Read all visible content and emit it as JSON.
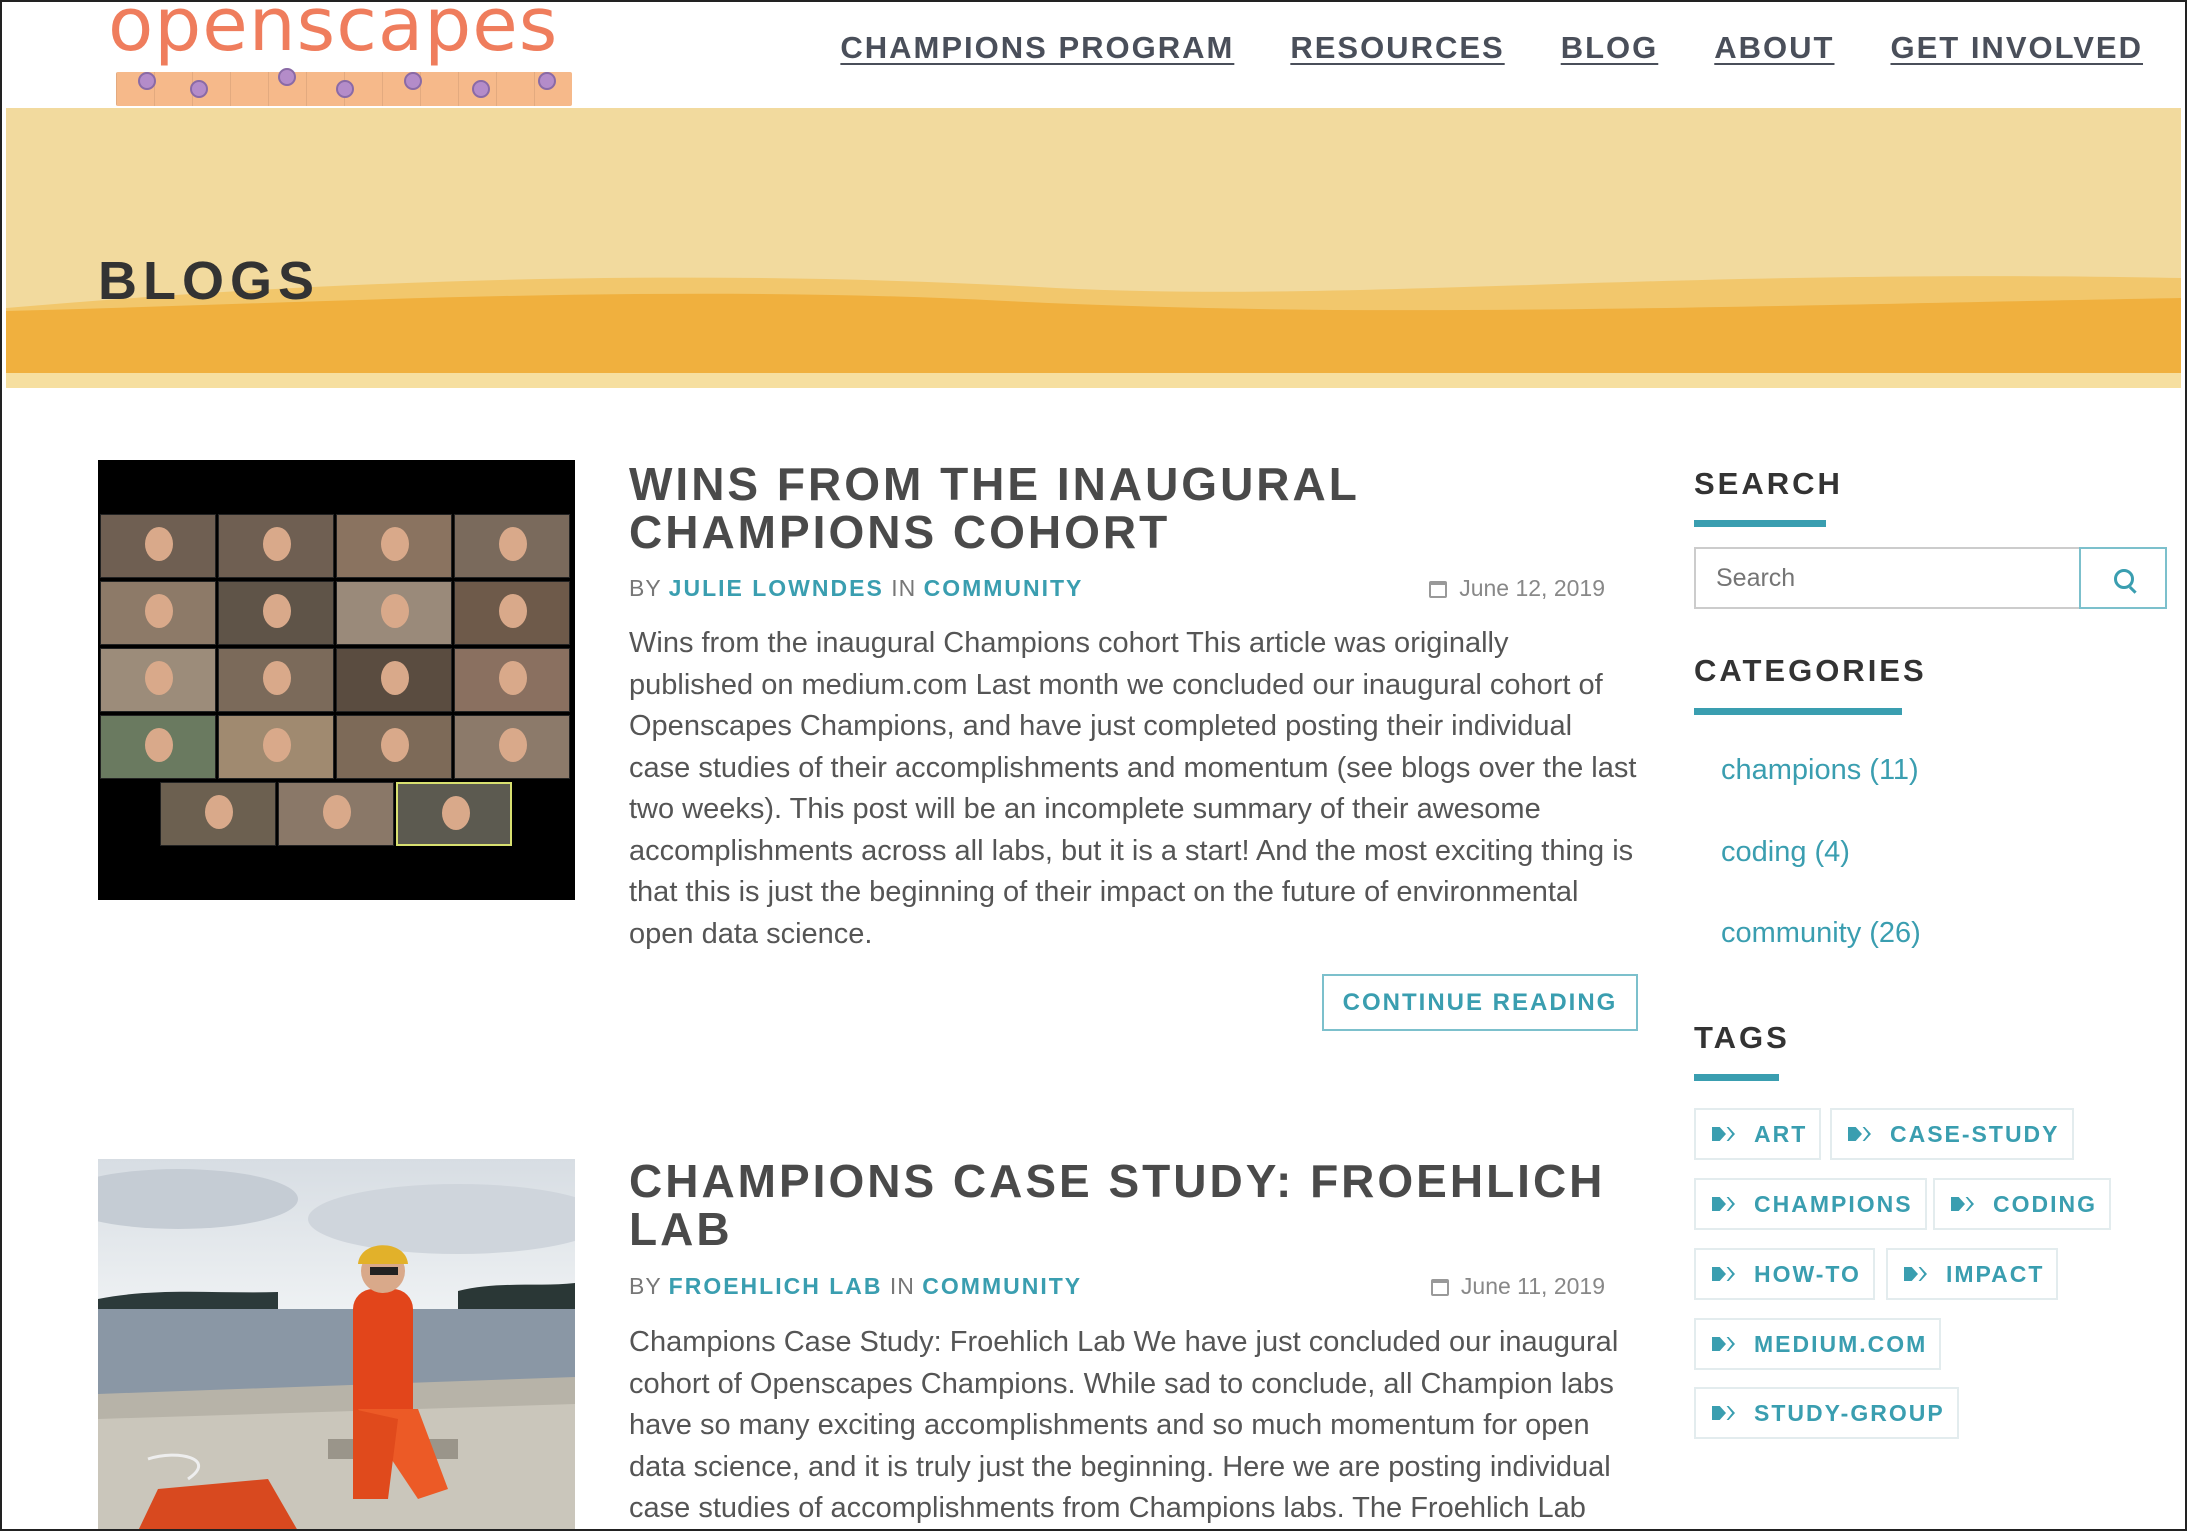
{
  "site": {
    "logo_text": "openscapes",
    "nav": [
      "CHAMPIONS PROGRAM",
      "RESOURCES",
      "BLOG",
      "ABOUT",
      "GET INVOLVED"
    ]
  },
  "banner": {
    "title": "BLOGS"
  },
  "posts": [
    {
      "title": "WINS FROM THE INAUGURAL CHAMPIONS COHORT",
      "by": "BY",
      "author": "JULIE LOWNDES",
      "in": "IN",
      "category": "COMMUNITY",
      "date": "June 12, 2019",
      "excerpt": "Wins from the inaugural Champions cohort This article was originally published on medium.com Last month we concluded our inaugural cohort of Openscapes Champions, and have just completed posting their individual case studies of their accomplishments and momentum (see blogs over the last two weeks). This post will be an incomplete summary of their awesome accomplishments across all labs, but it is a start! And the most exciting thing is that this is just the beginning of their impact on the future of environmental open data science.",
      "continue_label": "CONTINUE READING"
    },
    {
      "title": "CHAMPIONS CASE STUDY: FROEHLICH LAB",
      "by": "BY",
      "author": "FROEHLICH LAB",
      "in": "IN",
      "category": "COMMUNITY",
      "date": "June 11, 2019",
      "excerpt": "Champions Case Study: Froehlich Lab We have just concluded our inaugural cohort of Openscapes Champions. While sad to conclude, all Champion labs have so many exciting accomplishments and so much momentum for open data science, and it is truly just the beginning. Here we are posting individual case studies of accomplishments from Champions labs. The Froehlich Lab"
    }
  ],
  "sidebar": {
    "search_heading": "SEARCH",
    "search_placeholder": "Search",
    "categories_heading": "CATEGORIES",
    "categories": [
      "champions (11)",
      "coding (4)",
      "community (26)"
    ],
    "tags_heading": "TAGS",
    "tags": [
      "ART",
      "CASE-STUDY",
      "CHAMPIONS",
      "CODING",
      "HOW-TO",
      "IMPACT",
      "MEDIUM.COM",
      "STUDY-GROUP"
    ]
  },
  "icons": {
    "search": "search-icon",
    "calendar": "calendar-icon",
    "tag": "tags-icon"
  },
  "colors": {
    "accent": "#3a9eb0",
    "logo": "#ef7d5d",
    "banner_light": "#f2da9e",
    "banner_dark": "#f0b03e"
  }
}
